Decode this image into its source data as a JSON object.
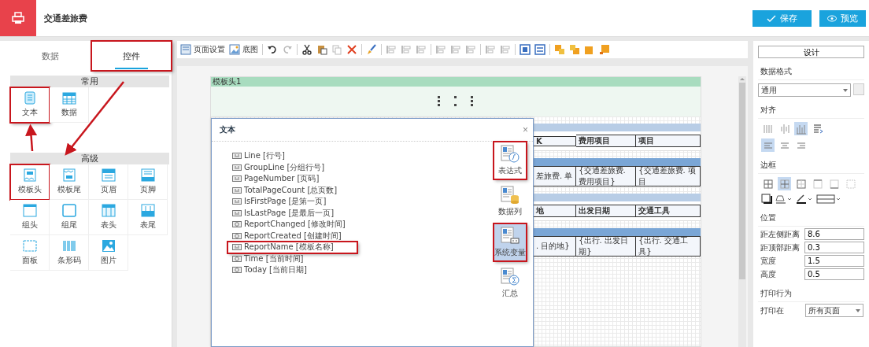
{
  "app": {
    "title": "交通差旅费"
  },
  "actions": [
    {
      "label": "保存",
      "kind": "save"
    },
    {
      "label": "预览",
      "kind": "preview"
    }
  ],
  "left_panel": {
    "tabs": [
      {
        "label": "数据",
        "selected": false,
        "highlighted": false
      },
      {
        "label": "控件",
        "selected": true,
        "highlighted": true
      }
    ],
    "groups": [
      {
        "title": "常用",
        "items": [
          {
            "label": "文本",
            "kind": "text",
            "highlighted": true
          },
          {
            "label": "数据",
            "kind": "table",
            "highlighted": false
          }
        ]
      },
      {
        "title": "高级",
        "items": [
          {
            "label": "模板头",
            "kind": "template-header",
            "highlighted": true
          },
          {
            "label": "模板尾",
            "kind": "template-footer",
            "highlighted": false
          },
          {
            "label": "页眉",
            "kind": "page-header",
            "highlighted": false
          },
          {
            "label": "页脚",
            "kind": "page-footer",
            "highlighted": false
          },
          {
            "label": "组头",
            "kind": "group-header",
            "highlighted": false
          },
          {
            "label": "组尾",
            "kind": "group-footer",
            "highlighted": false
          },
          {
            "label": "表头",
            "kind": "table-header",
            "highlighted": false
          },
          {
            "label": "表尾",
            "kind": "table-footer",
            "highlighted": false
          },
          {
            "label": "面板",
            "kind": "panel",
            "highlighted": false
          },
          {
            "label": "条形码",
            "kind": "barcode",
            "highlighted": false
          },
          {
            "label": "图片",
            "kind": "image",
            "highlighted": false
          }
        ]
      }
    ]
  },
  "toolbar": [
    {
      "kind": "page-setup",
      "label": "页面设置",
      "disabled": false
    },
    {
      "kind": "background",
      "label": "底图",
      "disabled": false
    },
    {
      "kind": "undo",
      "disabled": false
    },
    {
      "kind": "redo",
      "disabled": true
    },
    {
      "kind": "cut",
      "disabled": false
    },
    {
      "kind": "paste",
      "disabled": false
    },
    {
      "kind": "copy",
      "disabled": true
    },
    {
      "kind": "delete",
      "disabled": false
    },
    {
      "kind": "brush",
      "disabled": false
    },
    {
      "kind": "align-left",
      "disabled": true
    },
    {
      "kind": "align-center",
      "disabled": true
    },
    {
      "kind": "align-right",
      "disabled": true
    },
    {
      "kind": "align-top",
      "disabled": true
    },
    {
      "kind": "align-middle",
      "disabled": true
    },
    {
      "kind": "align-bottom",
      "disabled": true
    },
    {
      "kind": "space-h",
      "disabled": true
    },
    {
      "kind": "space-v",
      "disabled": true
    },
    {
      "kind": "same-width",
      "disabled": false
    },
    {
      "kind": "same-height",
      "disabled": false
    },
    {
      "kind": "bring-front",
      "disabled": false
    },
    {
      "kind": "send-back",
      "disabled": false
    },
    {
      "kind": "layer-up",
      "disabled": false
    },
    {
      "kind": "layer-down",
      "disabled": false
    }
  ],
  "canvas": {
    "band_title": "模板头1",
    "rows": [
      {
        "kind": "header",
        "color": "#b8cde6",
        "cells": [
          "K",
          "费用项目",
          "项目"
        ]
      },
      {
        "kind": "data",
        "color": "#7aa6d6",
        "cells": [
          "差旅费. 单",
          "{交通差旅费. 费用项目}",
          "{交通差旅费. 项目"
        ]
      },
      {
        "kind": "header",
        "color": "#b8cde6",
        "cells": [
          "地",
          "出发日期",
          "交通工具"
        ]
      },
      {
        "kind": "data",
        "color": "#7aa6d6",
        "cells": [
          ". 目的地}",
          "{出行. 出发日期}",
          "{出行. 交通工具}"
        ]
      }
    ]
  },
  "dialog": {
    "title": "文本",
    "close": "×",
    "items": [
      {
        "label": "Line [行号]",
        "kind": "number",
        "highlighted": false
      },
      {
        "label": "GroupLine [分组行号]",
        "kind": "number",
        "highlighted": false
      },
      {
        "label": "PageNumber [页码]",
        "kind": "number",
        "highlighted": false
      },
      {
        "label": "TotalPageCount [总页数]",
        "kind": "number",
        "highlighted": false
      },
      {
        "label": "IsFirstPage [是第一页]",
        "kind": "number",
        "highlighted": false
      },
      {
        "label": "IsLastPage [是最后一页]",
        "kind": "number",
        "highlighted": false
      },
      {
        "label": "ReportChanged [修改时间]",
        "kind": "time",
        "highlighted": false
      },
      {
        "label": "ReportCreated [创建时间]",
        "kind": "time",
        "highlighted": false
      },
      {
        "label": "ReportName [模板名称]",
        "kind": "number",
        "highlighted": true
      },
      {
        "label": "Time [当前时间]",
        "kind": "time",
        "highlighted": false
      },
      {
        "label": "Today [当前日期]",
        "kind": "time",
        "highlighted": false
      }
    ],
    "categories": [
      {
        "label": "表达式",
        "kind": "expression",
        "selected": false,
        "highlighted": true
      },
      {
        "label": "数据列",
        "kind": "column",
        "selected": false,
        "highlighted": false
      },
      {
        "label": "系统变量",
        "kind": "system",
        "selected": true,
        "highlighted": true
      },
      {
        "label": "汇总",
        "kind": "sum",
        "selected": false,
        "highlighted": false
      }
    ]
  },
  "properties": {
    "tab": "设计",
    "format": {
      "label": "数据格式",
      "value": "通用"
    },
    "align": {
      "label": "对齐",
      "vertical": [
        {
          "kind": "justify",
          "selected": false
        },
        {
          "kind": "center",
          "selected": false
        },
        {
          "kind": "distribute",
          "selected": true
        },
        {
          "kind": "wrap",
          "selected": false
        }
      ],
      "horizontal": [
        {
          "kind": "left",
          "selected": true
        },
        {
          "kind": "center",
          "selected": false
        },
        {
          "kind": "right",
          "selected": false
        }
      ]
    },
    "border": {
      "label": "边框",
      "styles": [
        {
          "kind": "all",
          "selected": false
        },
        {
          "kind": "inner",
          "selected": true
        },
        {
          "kind": "outer",
          "selected": false
        },
        {
          "kind": "top",
          "selected": false
        },
        {
          "kind": "bottom",
          "selected": false
        },
        {
          "kind": "none",
          "selected": false
        }
      ]
    },
    "position": {
      "label": "位置",
      "fields": [
        {
          "label": "距左侧距离",
          "value": "8.6"
        },
        {
          "label": "距顶部距离",
          "value": "0.3"
        },
        {
          "label": "宽度",
          "value": "1.5"
        },
        {
          "label": "高度",
          "value": "0.5"
        }
      ]
    },
    "print": {
      "label": "打印行为",
      "field": "打印在",
      "value": "所有页面"
    }
  }
}
